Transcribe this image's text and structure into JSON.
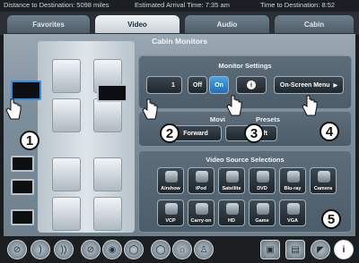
{
  "status": {
    "distance": "Distance to Destination: 5098 miles",
    "arrival": "Estimated Arrival Time: 7:35 am",
    "time_to_dest": "Time to Destination: 8:52"
  },
  "tabs": [
    {
      "label": "Favorites",
      "active": false
    },
    {
      "label": "Video",
      "active": true
    },
    {
      "label": "Audio",
      "active": false
    },
    {
      "label": "Cabin",
      "active": false
    }
  ],
  "page_title": "Cabin Monitors",
  "monitor_settings": {
    "title": "Monitor Settings",
    "monitor_id": "1",
    "off_label": "Off",
    "on_label": "On",
    "info_label": "i",
    "osm_label": "On-Screen Menu"
  },
  "presets": {
    "title_visible": "Movi",
    "title_visible_end": "Presets",
    "forward_label": "Forward",
    "aft_partial": "ft"
  },
  "video_sources": {
    "title": "Video Source Selections",
    "row1": [
      "Airshow",
      "iPod",
      "Satellite",
      "DVD",
      "Blu-ray",
      "Camera"
    ],
    "row2": [
      "VCP",
      "Carry-on",
      "HD",
      "Game",
      "VGA"
    ]
  },
  "callouts": [
    "1",
    "2",
    "3",
    "4",
    "5"
  ],
  "colors": {
    "accent": "#2f8ee0",
    "on_button": "#1d6fb8"
  }
}
